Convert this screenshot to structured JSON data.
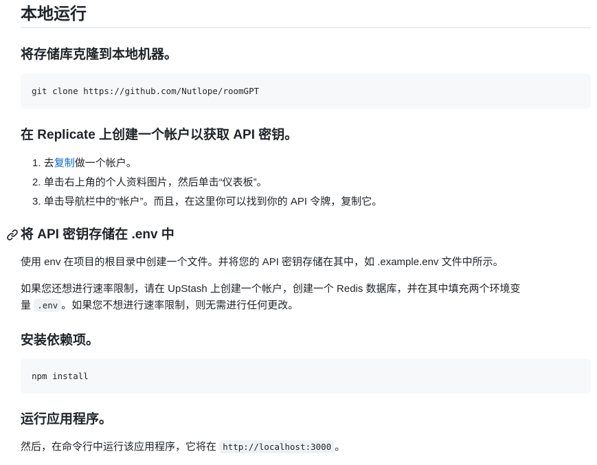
{
  "title": "本地运行",
  "step_clone": {
    "heading": "将存储库克隆到本地机器。",
    "code": "git clone https://github.com/Nutlope/roomGPT"
  },
  "step_replicate": {
    "heading": "在 Replicate 上创建一个帐户以获取 API 密钥。",
    "items": [
      {
        "num": "1.",
        "before": "去",
        "link": "复制",
        "after": "做一个帐户。"
      },
      {
        "num": "2.",
        "text": "单击右上角的个人资料图片，然后单击“仪表板”。"
      },
      {
        "num": "3.",
        "text": "单击导航栏中的“帐户”。而且，在这里你可以找到你的 API 令牌，复制它。"
      }
    ]
  },
  "step_env": {
    "heading": "将 API 密钥存储在 .env 中",
    "para1": "使用 env 在项目的根目录中创建一个文件。并将您的 API 密钥存储在其中，如 .example.env 文件中所示。",
    "para2_line1": "如果您还想进行速率限制，请在 UpStash 上创建一个帐户，创建一个 Redis 数据库，并在其中填充两个环境变",
    "para2_line2_before": "量",
    "para2_code": ".env",
    "para2_line2_after": "。如果您不想进行速率限制，则无需进行任何更改。"
  },
  "step_install": {
    "heading": "安装依赖项。",
    "code": "npm install"
  },
  "step_run": {
    "heading": "运行应用程序。",
    "para_before": "然后，在命令行中运行该应用程序，它将在",
    "code": "http://localhost:3000",
    "para_after": "。"
  },
  "icons": {
    "anchor": "link-icon"
  }
}
